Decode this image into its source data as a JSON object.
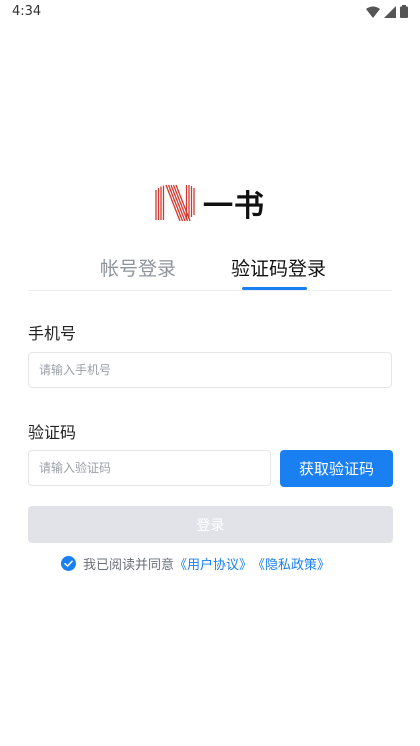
{
  "status_bar": {
    "time": "4:34",
    "icons": [
      "wifi-icon",
      "signal-icon",
      "battery-icon"
    ]
  },
  "logo": {
    "text": "一书",
    "icon": "striped-n-logo"
  },
  "tabs": [
    {
      "label": "帐号登录",
      "active": false
    },
    {
      "label": "验证码登录",
      "active": true
    }
  ],
  "form": {
    "phone_label": "手机号",
    "phone_placeholder": "请输入手机号",
    "phone_value": "",
    "code_label": "验证码",
    "code_placeholder": "请输入验证码",
    "code_value": "",
    "get_code_label": "获取验证码",
    "login_label": "登录"
  },
  "agreement": {
    "checked": true,
    "text": "我已阅读并同意",
    "user_agreement": "《用户协议》",
    "privacy_policy": "《隐私政策》"
  },
  "colors": {
    "accent": "#1a7ff0",
    "logo_red": "#d0392f",
    "disabled": "#e1e3e9"
  }
}
